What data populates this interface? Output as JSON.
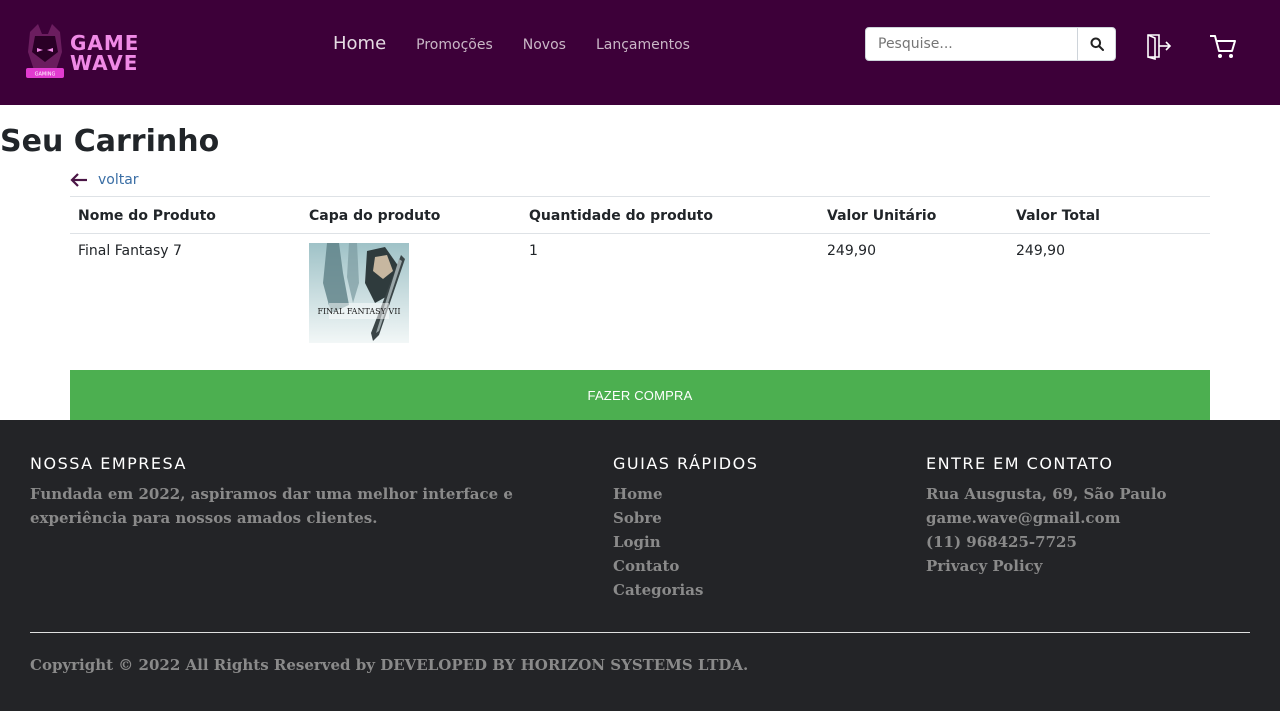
{
  "brand": {
    "logo_line1": "GAME",
    "logo_line2": "WAVE",
    "logo_badge": "GAMING",
    "colors": {
      "header_bg": "#3d0039",
      "logo": "#f08ae6",
      "buy_button": "#4caf50",
      "footer_bg": "#232427"
    }
  },
  "nav": {
    "items": [
      {
        "label": "Home"
      },
      {
        "label": "Promoções"
      },
      {
        "label": "Novos"
      },
      {
        "label": "Lançamentos"
      }
    ]
  },
  "search": {
    "placeholder": "Pesquise...",
    "icon": "search-icon"
  },
  "header_icons": {
    "logout": "logout-icon",
    "cart": "cart-icon"
  },
  "page": {
    "title": "Seu Carrinho",
    "back_label": "voltar"
  },
  "table": {
    "headers": [
      "Nome do Produto",
      "Capa do produto",
      "Quantidade do produto",
      "Valor Unitário",
      "Valor Total"
    ],
    "rows": [
      {
        "name": "Final Fantasy 7",
        "cover_text": "FINAL FANTASY VII",
        "quantity": "1",
        "unit_price": "249,90",
        "total": "249,90"
      }
    ]
  },
  "buy_button": "FAZER COMPRA",
  "footer": {
    "company": {
      "title": "NOSSA EMPRESA",
      "text_line1": "Fundada em 2022, aspiramos dar uma melhor interface e",
      "text_line2": "experiência para nossos amados clientes."
    },
    "guides": {
      "title": "GUIAS RÁPIDOS",
      "links": [
        "Home",
        "Sobre",
        "Login",
        "Contato",
        "Categorias"
      ]
    },
    "contact": {
      "title": "ENTRE EM CONTATO",
      "lines": [
        "Rua Ausgusta, 69, São Paulo",
        "game.wave@gmail.com",
        "(11) 968425-7725",
        "Privacy Policy"
      ]
    },
    "copyright": "Copyright © 2022 All Rights Reserved by DEVELOPED BY HORIZON SYSTEMS LTDA."
  }
}
